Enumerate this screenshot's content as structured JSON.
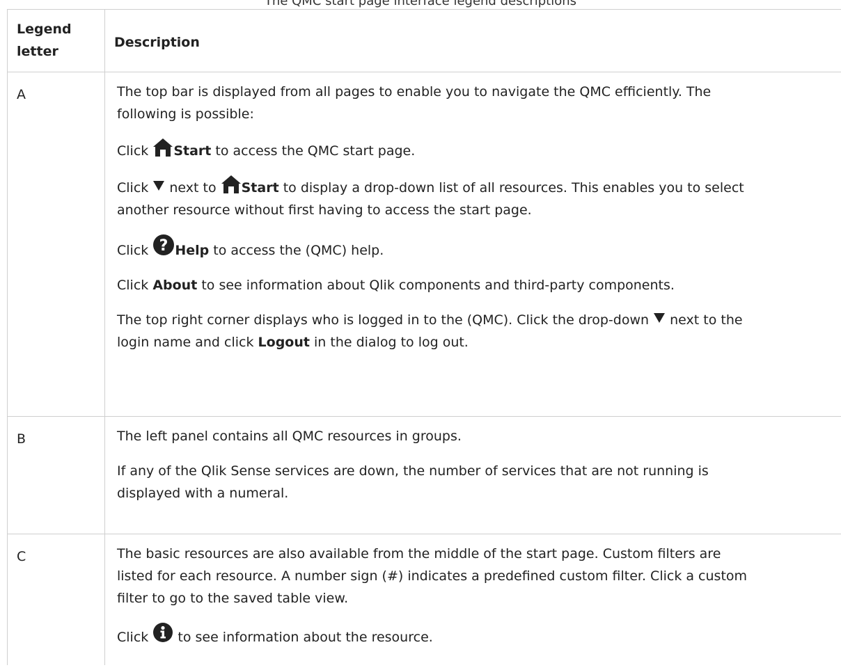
{
  "caption": "The QMC start page interface legend descriptions",
  "table": {
    "headers": {
      "letter": "Legend letter",
      "description": "Description"
    },
    "rows": [
      {
        "letter": "A",
        "p1_line1": "The top bar is displayed from all pages to enable you to navigate the QMC efficiently. The",
        "p1_line2": "following is possible:",
        "click": "Click",
        "start": "Start",
        "p2_rest": " to access the QMC start page.",
        "next_to": " next to ",
        "p3_rest": " to display a drop-down list of all resources. This enables you to select",
        "p3_line2": "another resource without first having to access the start page.",
        "help": "Help",
        "p4_rest": " to access the (QMC) help.",
        "about": "About",
        "p5_rest": " to see information about Qlik components and third-party components.",
        "p6_part1": "The top right corner displays who is logged in to the (QMC). Click the drop-down ",
        "p6_part2": " next to the",
        "p6_line2_a": "login name and click ",
        "logout": "Logout",
        "p6_line2_b": " in the dialog to log out."
      },
      {
        "letter": "B",
        "p1": "The left panel contains all QMC resources in groups.",
        "p2_line1": "If any of the Qlik Sense services are down, the number of services that are not running is",
        "p2_line2": "displayed with a numeral."
      },
      {
        "letter": "C",
        "p1_line1": "The basic resources are also available from the middle of the start page. Custom filters are",
        "p1_line2": "listed for each resource. A number sign (#) indicates a predefined custom filter. Click a custom",
        "p1_line3": "filter to go to the saved table view.",
        "click": "Click",
        "p2_rest": " to see information about the resource."
      }
    ]
  },
  "icons": {
    "home": "home-icon",
    "triangle": "triangle-down-icon",
    "help": "help-icon",
    "info": "info-icon"
  }
}
